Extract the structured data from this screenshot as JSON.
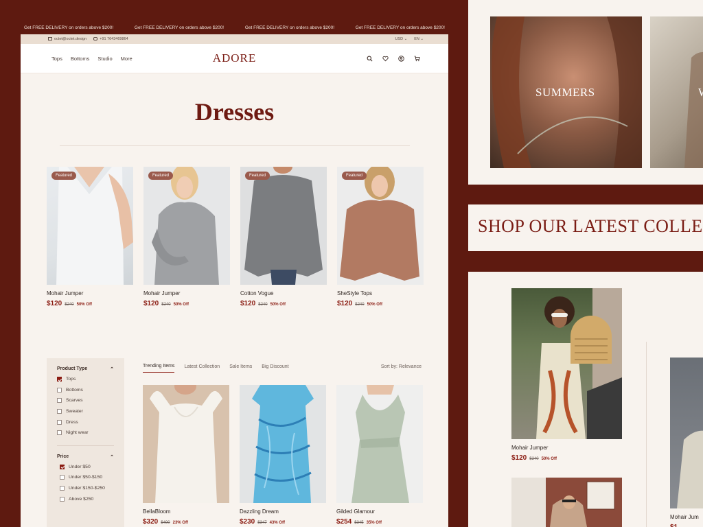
{
  "promo": {
    "messages": [
      "Get FREE DELIVERY on orders above $200!",
      "Get FREE DELIVERY on orders above $200!",
      "Get FREE DELIVERY on orders above $200!",
      "Get FREE DELIVERY on orders above $200!"
    ]
  },
  "utility": {
    "email": "octet@octet.design",
    "phone": "+91 7643469864",
    "currency": "USD",
    "language": "EN"
  },
  "header": {
    "nav": [
      "Tops",
      "Bottoms",
      "Studio",
      "More"
    ],
    "brand": "ADORE"
  },
  "page": {
    "title": "Dresses"
  },
  "featured": [
    {
      "badge": "Featured",
      "name": "Mohair Jumper",
      "price": "$120",
      "old_price": "$240",
      "discount": "50% Off"
    },
    {
      "badge": "Featured",
      "name": "Mohair Jumper",
      "price": "$120",
      "old_price": "$240",
      "discount": "50% Off"
    },
    {
      "badge": "Featured",
      "name": "Cotton Vogue",
      "price": "$120",
      "old_price": "$240",
      "discount": "50% Off"
    },
    {
      "badge": "Featured",
      "name": "SheStyle Tops",
      "price": "$120",
      "old_price": "$240",
      "discount": "50% Off"
    }
  ],
  "filters": {
    "product_type": {
      "title": "Product Type",
      "options": [
        {
          "label": "Tops",
          "checked": true
        },
        {
          "label": "Bottoms",
          "checked": false
        },
        {
          "label": "Scarves",
          "checked": false
        },
        {
          "label": "Sweater",
          "checked": false
        },
        {
          "label": "Dress",
          "checked": false
        },
        {
          "label": "Night wear",
          "checked": false
        }
      ]
    },
    "price": {
      "title": "Price",
      "options": [
        {
          "label": "Under $50",
          "checked": true
        },
        {
          "label": "Under $50-$150",
          "checked": false
        },
        {
          "label": "Under $150-$250",
          "checked": false
        },
        {
          "label": "Above $250",
          "checked": false
        }
      ]
    }
  },
  "tabs": {
    "items": [
      "Trending Items",
      "Latest Collection",
      "Sale Items",
      "Big Discount"
    ],
    "active": 0,
    "sort": "Sort by: Relevance"
  },
  "trending": [
    {
      "name": "BellaBloom",
      "price": "$320",
      "old_price": "$490",
      "discount": "23% Off"
    },
    {
      "name": "Dazzling Dream",
      "price": "$230",
      "old_price": "$347",
      "discount": "43% Off"
    },
    {
      "name": "Gilded Glamour",
      "price": "$254",
      "old_price": "$345",
      "discount": "35% Off"
    }
  ],
  "right": {
    "categories": [
      "SUMMERS",
      "W"
    ],
    "collection_title": "SHOP OUR LATEST COLLECTION",
    "products": [
      {
        "name": "Mohair Jumper",
        "price": "$120",
        "old_price": "$240",
        "discount": "50% Off"
      },
      {
        "name": "Mohair Jum",
        "price": "$1"
      }
    ]
  },
  "colors": {
    "brand": "#7a1c14",
    "background": "#5e1a10",
    "accent_price": "#8b1c12"
  }
}
